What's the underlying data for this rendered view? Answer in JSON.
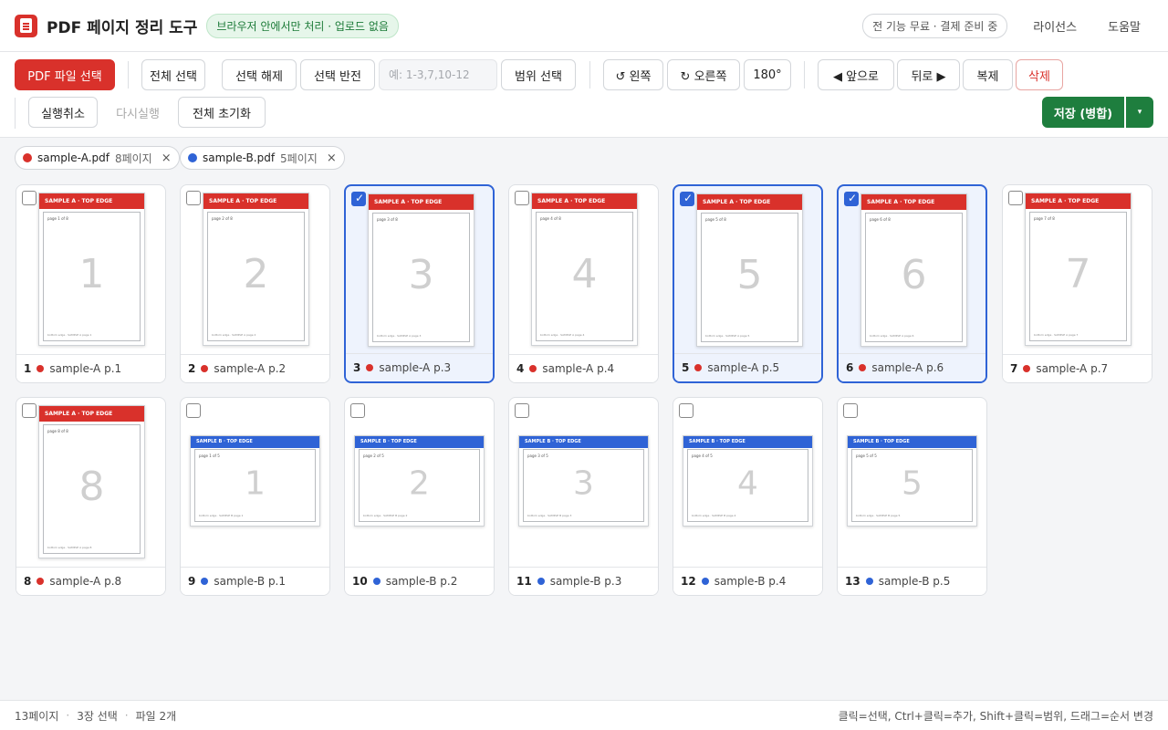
{
  "header": {
    "title": "PDF 페이지 정리 도구",
    "badge": "브라우저 안에서만 처리 · 업로드 없음",
    "free_pill": "전 기능 무료 · 결제 준비 중",
    "license": "라이선스",
    "help": "도움말"
  },
  "toolbar": {
    "select_pdf": "PDF 파일 선택",
    "select_all": "전체 선택",
    "deselect": "선택 해제",
    "invert": "선택 반전",
    "range_placeholder": "예: 1-3,7,10-12",
    "range_select": "범위 선택",
    "rotate_left": "↺ 왼쪽",
    "rotate_right": "↻ 오른쪽",
    "rotate_180": "180°",
    "move_forward": "◀ 앞으로",
    "move_back": "뒤로 ▶",
    "duplicate": "복제",
    "delete": "삭제",
    "undo": "실행취소",
    "redo": "다시실행",
    "reset": "전체 초기화",
    "save": "저장 (병합)",
    "save_menu": "▾"
  },
  "files": [
    {
      "name": "sample-A.pdf",
      "count": "8페이지",
      "color": "#d9312b",
      "remove": "×"
    },
    {
      "name": "sample-B.pdf",
      "count": "5페이지",
      "color": "#2f63d6",
      "remove": "×"
    }
  ],
  "pages": [
    {
      "index": "1",
      "label": "sample-A p.1",
      "big": "1",
      "band": "SAMPLE A  ·  TOP EDGE",
      "small": "page 1 of 8",
      "bottom": "bottom edge · SAMPLE A page 1",
      "file": "A",
      "selected": false,
      "check": ""
    },
    {
      "index": "2",
      "label": "sample-A p.2",
      "big": "2",
      "band": "SAMPLE A  ·  TOP EDGE",
      "small": "page 2 of 8",
      "bottom": "bottom edge · SAMPLE A page 2",
      "file": "A",
      "selected": false,
      "check": ""
    },
    {
      "index": "3",
      "label": "sample-A p.3",
      "big": "3",
      "band": "SAMPLE A  ·  TOP EDGE",
      "small": "page 3 of 8",
      "bottom": "bottom edge · SAMPLE A page 3",
      "file": "A",
      "selected": true,
      "check": "✓"
    },
    {
      "index": "4",
      "label": "sample-A p.4",
      "big": "4",
      "band": "SAMPLE A  ·  TOP EDGE",
      "small": "page 4 of 8",
      "bottom": "bottom edge · SAMPLE A page 4",
      "file": "A",
      "selected": false,
      "check": ""
    },
    {
      "index": "5",
      "label": "sample-A p.5",
      "big": "5",
      "band": "SAMPLE A  ·  TOP EDGE",
      "small": "page 5 of 8",
      "bottom": "bottom edge · SAMPLE A page 5",
      "file": "A",
      "selected": true,
      "check": "✓"
    },
    {
      "index": "6",
      "label": "sample-A p.6",
      "big": "6",
      "band": "SAMPLE A  ·  TOP EDGE",
      "small": "page 6 of 8",
      "bottom": "bottom edge · SAMPLE A page 6",
      "file": "A",
      "selected": true,
      "check": "✓"
    },
    {
      "index": "7",
      "label": "sample-A p.7",
      "big": "7",
      "band": "SAMPLE A  ·  TOP EDGE",
      "small": "page 7 of 8",
      "bottom": "bottom edge · SAMPLE A page 7",
      "file": "A",
      "selected": false,
      "check": ""
    },
    {
      "index": "8",
      "label": "sample-A p.8",
      "big": "8",
      "band": "SAMPLE A  ·  TOP EDGE",
      "small": "page 8 of 8",
      "bottom": "bottom edge · SAMPLE A page 8",
      "file": "A",
      "selected": false,
      "check": ""
    },
    {
      "index": "9",
      "label": "sample-B p.1",
      "big": "1",
      "band": "SAMPLE B  ·  TOP EDGE",
      "small": "page 1 of 5",
      "bottom": "bottom edge · SAMPLE B page 1",
      "file": "B",
      "selected": false,
      "check": ""
    },
    {
      "index": "10",
      "label": "sample-B p.2",
      "big": "2",
      "band": "SAMPLE B  ·  TOP EDGE",
      "small": "page 2 of 5",
      "bottom": "bottom edge · SAMPLE B page 2",
      "file": "B",
      "selected": false,
      "check": ""
    },
    {
      "index": "11",
      "label": "sample-B p.3",
      "big": "3",
      "band": "SAMPLE B  ·  TOP EDGE",
      "small": "page 3 of 5",
      "bottom": "bottom edge · SAMPLE B page 3",
      "file": "B",
      "selected": false,
      "check": ""
    },
    {
      "index": "12",
      "label": "sample-B p.4",
      "big": "4",
      "band": "SAMPLE B  ·  TOP EDGE",
      "small": "page 4 of 5",
      "bottom": "bottom edge · SAMPLE B page 4",
      "file": "B",
      "selected": false,
      "check": ""
    },
    {
      "index": "13",
      "label": "sample-B p.5",
      "big": "5",
      "band": "SAMPLE B  ·  TOP EDGE",
      "small": "page 5 of 5",
      "bottom": "bottom edge · SAMPLE B page 5",
      "file": "B",
      "selected": false,
      "check": ""
    }
  ],
  "status": {
    "pages": "13페이지",
    "selected": "3장 선택",
    "files": "파일 2개",
    "sep": "·",
    "hint": "클릭=선택, Ctrl+클릭=추가, Shift+클릭=범위, 드래그=순서 변경"
  },
  "colors": {
    "accent": "#d9312b",
    "file_a": "#d9312b",
    "file_b": "#2f63d6",
    "save": "#1e7e3e",
    "selection": "#2f63d6"
  }
}
